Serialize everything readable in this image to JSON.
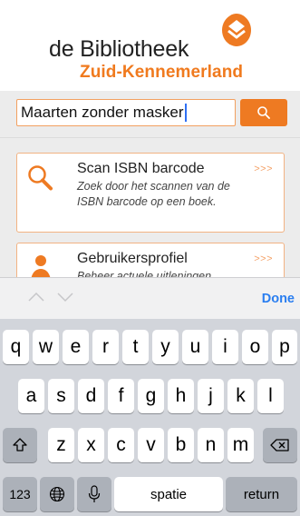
{
  "header": {
    "logo_line1": "de Bibliotheek",
    "logo_line2": "Zuid-Kennemerland",
    "brand_color": "#ee7a22"
  },
  "search": {
    "value": "Maarten zonder masker",
    "button_icon": "search-icon"
  },
  "cards": [
    {
      "title": "Scan ISBN barcode",
      "description": "Zoek door het scannen van de ISBN barcode op een boek.",
      "arrow": ">>>",
      "icon": "magnifier-icon"
    },
    {
      "title": "Gebruikersprofiel",
      "description": "Beheer actuele uitleningen",
      "arrow": ">>>",
      "icon": "person-icon"
    }
  ],
  "accessory": {
    "done_label": "Done"
  },
  "keyboard": {
    "row1": [
      "q",
      "w",
      "e",
      "r",
      "t",
      "y",
      "u",
      "i",
      "o",
      "p"
    ],
    "row2": [
      "a",
      "s",
      "d",
      "f",
      "g",
      "h",
      "j",
      "k",
      "l"
    ],
    "row3": [
      "z",
      "x",
      "c",
      "v",
      "b",
      "n",
      "m"
    ],
    "numbers_label": "123",
    "space_label": "spatie",
    "return_label": "return"
  }
}
